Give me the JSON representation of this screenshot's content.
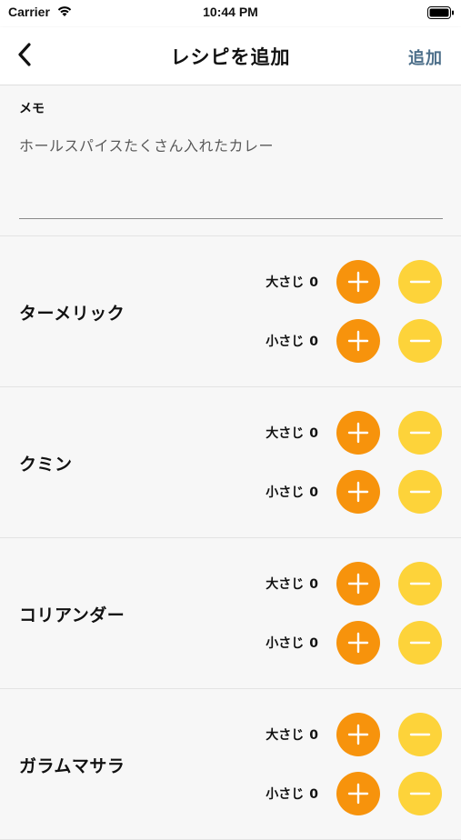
{
  "status_bar": {
    "carrier": "Carrier",
    "time": "10:44 PM"
  },
  "nav": {
    "title": "レシピを追加",
    "add_label": "追加",
    "accent_color": "#4d6f8a"
  },
  "memo": {
    "label": "メモ",
    "value": "ホールスパイスたくさん入れたカレー"
  },
  "ingredients": [
    {
      "name": "ターメリック",
      "tbsp_label": "大さじ",
      "tbsp_count": "0",
      "tsp_label": "小さじ",
      "tsp_count": "0"
    },
    {
      "name": "クミン",
      "tbsp_label": "大さじ",
      "tbsp_count": "0",
      "tsp_label": "小さじ",
      "tsp_count": "0"
    },
    {
      "name": "コリアンダー",
      "tbsp_label": "大さじ",
      "tbsp_count": "0",
      "tsp_label": "小さじ",
      "tsp_count": "0"
    },
    {
      "name": "ガラムマサラ",
      "tbsp_label": "大さじ",
      "tbsp_count": "0",
      "tsp_label": "小さじ",
      "tsp_count": "0"
    }
  ],
  "colors": {
    "plus_button": "#f7930c",
    "minus_button": "#fdd33a"
  },
  "icons": {
    "back": "chevron-left-icon",
    "plus": "plus-icon",
    "minus": "minus-icon",
    "wifi": "wifi-icon",
    "battery": "battery-icon"
  }
}
